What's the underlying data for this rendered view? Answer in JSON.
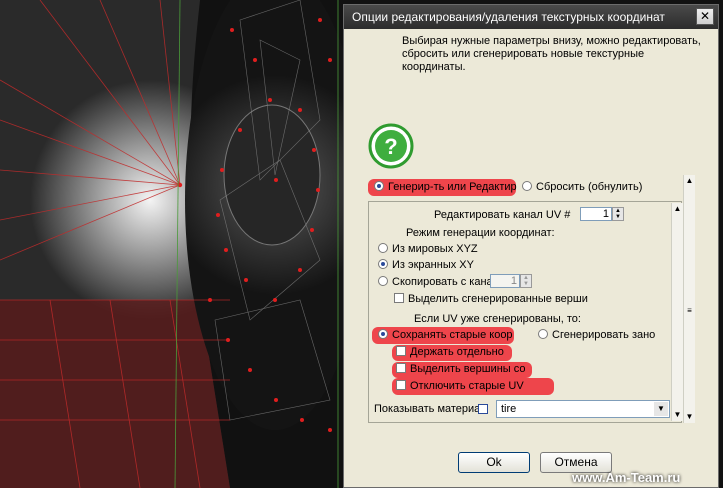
{
  "dialog": {
    "title": "Опции редактирования/удаления текстурных координат",
    "close_glyph": "✕",
    "description": "Выбирая нужные параметры внизу, можно редактировать, сбросить или сгенерировать новые текстурные координаты.",
    "help_icon": "question-icon",
    "mode_generate_label": "Генерир-ть или Редактир",
    "mode_reset_label": "Сбросить (обнулить)",
    "edit_channel_label": "Редактировать канал UV #",
    "edit_channel_value": "1",
    "generation_group_label": "Режим генерации координат:",
    "gen_world_label": "Из мировых XYZ",
    "gen_screen_label": "Из экранных XY",
    "gen_copy_label": "Скопировать с кана",
    "copy_channel_value": "1",
    "select_generated_label": "Выделить сгенерированные верши",
    "existing_group_label": "Если UV уже сгенерированы, то:",
    "keep_old_label": "Сохранять старые коор",
    "regenerate_label": "Сгенерировать зано",
    "keep_separate_label": "Держать отдельно",
    "select_vertices_label": "Выделить вершины со",
    "disable_old_label": "Отключить старые UV",
    "show_material_label": "Показывать материал",
    "material_value": "tire",
    "ok_label": "Ok",
    "cancel_label": "Отмена"
  },
  "watermark": "www.Am-Team.ru",
  "colors": {
    "highlight": "#ee2832",
    "dialog_bg": "#ece9d8",
    "help_green": "#2f9b2f"
  }
}
